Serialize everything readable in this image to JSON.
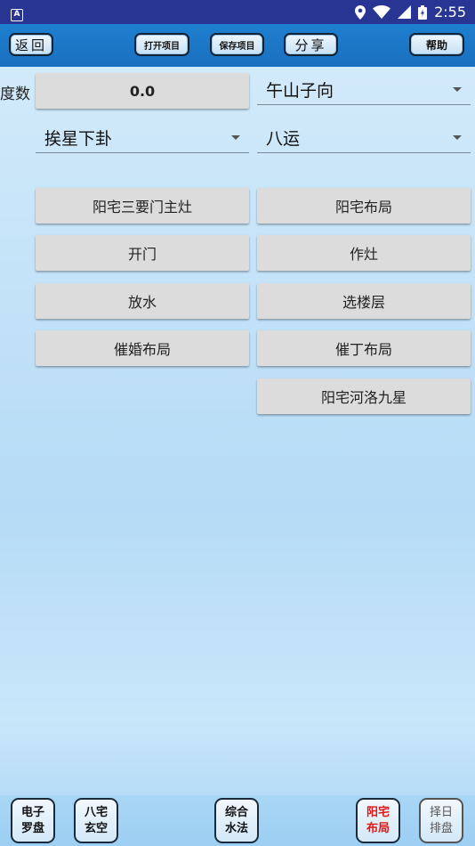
{
  "status_bar": {
    "app_icon_letter": "A",
    "time": "2:55"
  },
  "toolbar": {
    "back_label": "返回",
    "open_project_label": "打开项目",
    "save_project_label": "保存项目",
    "share_label": "分享",
    "help_label": "帮助"
  },
  "form": {
    "degree_label": "度数",
    "degree_value": "0.0",
    "direction_value": "午山子向",
    "star_method_value": "挨星下卦",
    "period_value": "八运"
  },
  "actions": [
    "阳宅三要门主灶",
    "阳宅布局",
    "开门",
    "作灶",
    "放水",
    "选楼层",
    "催婚布局",
    "催丁布局",
    "阳宅河洛九星"
  ],
  "bottom_nav": [
    {
      "line1": "电子",
      "line2": "罗盘",
      "state": "normal"
    },
    {
      "line1": "八宅",
      "line2": "玄空",
      "state": "normal"
    },
    {
      "line1": "综合",
      "line2": "水法",
      "state": "normal"
    },
    {
      "line1": "阳宅",
      "line2": "布局",
      "state": "active"
    },
    {
      "line1": "择日",
      "line2": "排盘",
      "state": "dim"
    }
  ],
  "colors": {
    "status_bar": "#283593",
    "toolbar": "#1a6fbf",
    "active_tab_text": "#e01818"
  }
}
